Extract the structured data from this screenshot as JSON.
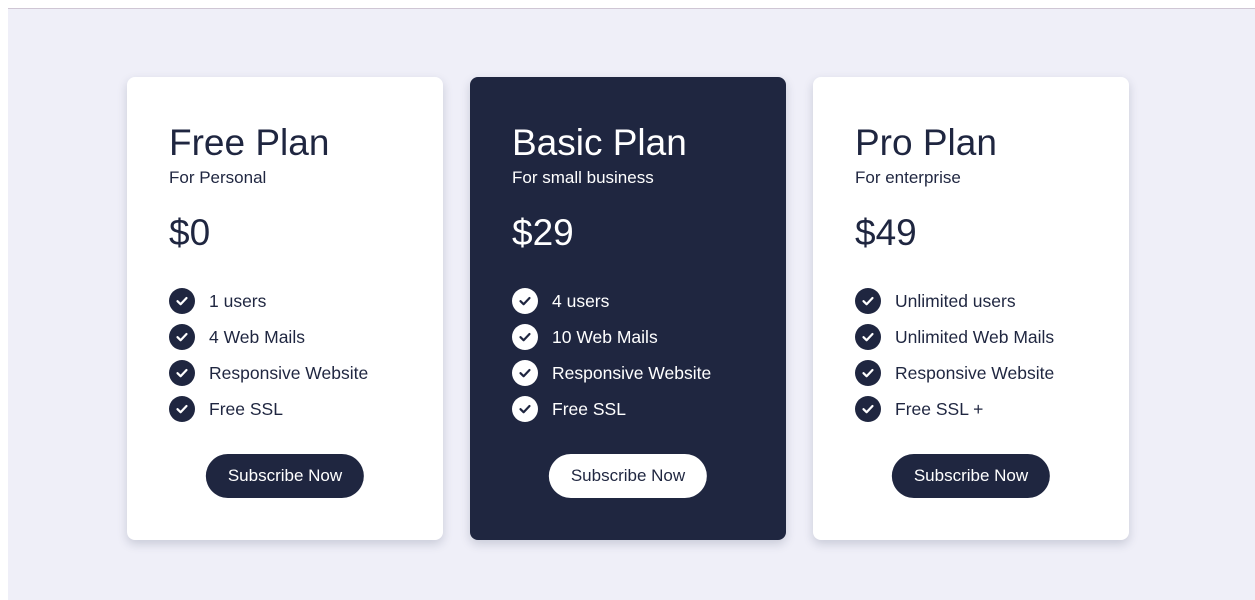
{
  "colors": {
    "page_background": "#efeff8",
    "navy": "#1f2640",
    "card_background": "#ffffff"
  },
  "plans": [
    {
      "name": "Free Plan",
      "subtitle": "For Personal",
      "price": "$0",
      "features": [
        "1 users",
        "4 Web Mails",
        "Responsive Website",
        "Free SSL"
      ],
      "button_label": "Subscribe Now",
      "highlighted": false
    },
    {
      "name": "Basic Plan",
      "subtitle": "For small business",
      "price": "$29",
      "features": [
        "4 users",
        "10 Web Mails",
        "Responsive Website",
        "Free SSL"
      ],
      "button_label": "Subscribe Now",
      "highlighted": true
    },
    {
      "name": "Pro Plan",
      "subtitle": "For enterprise",
      "price": "$49",
      "features": [
        "Unlimited users",
        "Unlimited Web Mails",
        "Responsive Website",
        "Free SSL +"
      ],
      "button_label": "Subscribe Now",
      "highlighted": false
    }
  ],
  "icons": {
    "feature_bullet": "check-circle-icon"
  }
}
